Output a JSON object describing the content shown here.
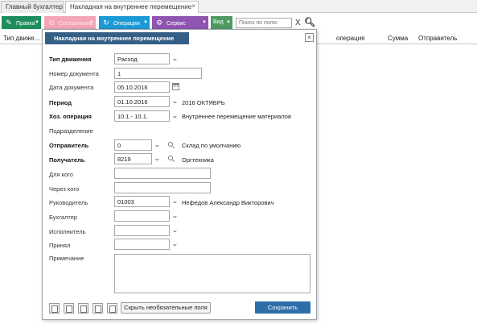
{
  "tabs": [
    {
      "label": "Главный бухгалтер"
    },
    {
      "label": "Накладная на внутреннее перемещение",
      "close": "×"
    }
  ],
  "toolbar": {
    "pravka": "Правка",
    "sostavlenie": "Составление",
    "operacii": "Операции",
    "servis": "Сервис",
    "vid": "Вид",
    "search_placeholder": "Поиск по полю",
    "clear_label": "X"
  },
  "grid": {
    "columns": [
      "Тип движе...",
      "операция",
      "Сумма",
      "Отправитель"
    ]
  },
  "dialog": {
    "title": "Накладная на внутреннее перемещение",
    "close": "×",
    "fields": {
      "tip_dvizheniya": {
        "label": "Тип движения",
        "value": "Расход"
      },
      "nomer": {
        "label": "Номер документа",
        "value": "1"
      },
      "data": {
        "label": "Дата документа",
        "value": "05.10.2016"
      },
      "period": {
        "label": "Период",
        "value": "01.10.2016",
        "desc": "2016 ОКТЯБРЬ"
      },
      "hoz_oper": {
        "label": "Хоз. операция",
        "value": "10.1.- 10.1.",
        "desc": "Внутреннее перемещение материалов"
      },
      "podrazdelenie": {
        "label": "Подразделение"
      },
      "otpravitel": {
        "label": "Отправитель",
        "value": "0",
        "desc": "Склад по умолчанию"
      },
      "poluchatel": {
        "label": "Получатель",
        "value": "8219",
        "desc": "Оргтехника"
      },
      "dlya_kogo": {
        "label": "Для кого",
        "value": ""
      },
      "cherez_kogo": {
        "label": "Через кого",
        "value": ""
      },
      "rukovoditel": {
        "label": "Руководитель",
        "value": "01003",
        "desc": "Нефедов Александр Викторович"
      },
      "buhgalter": {
        "label": "Бухгалтер",
        "value": ""
      },
      "ispolnitel": {
        "label": "Исполнитель",
        "value": ""
      },
      "prinyal": {
        "label": "Принял",
        "value": ""
      },
      "primechanie": {
        "label": "Примечание",
        "value": ""
      }
    },
    "buttons": {
      "hide_optional": "Скрыть необязательные поля",
      "save": "Сохранить"
    }
  }
}
